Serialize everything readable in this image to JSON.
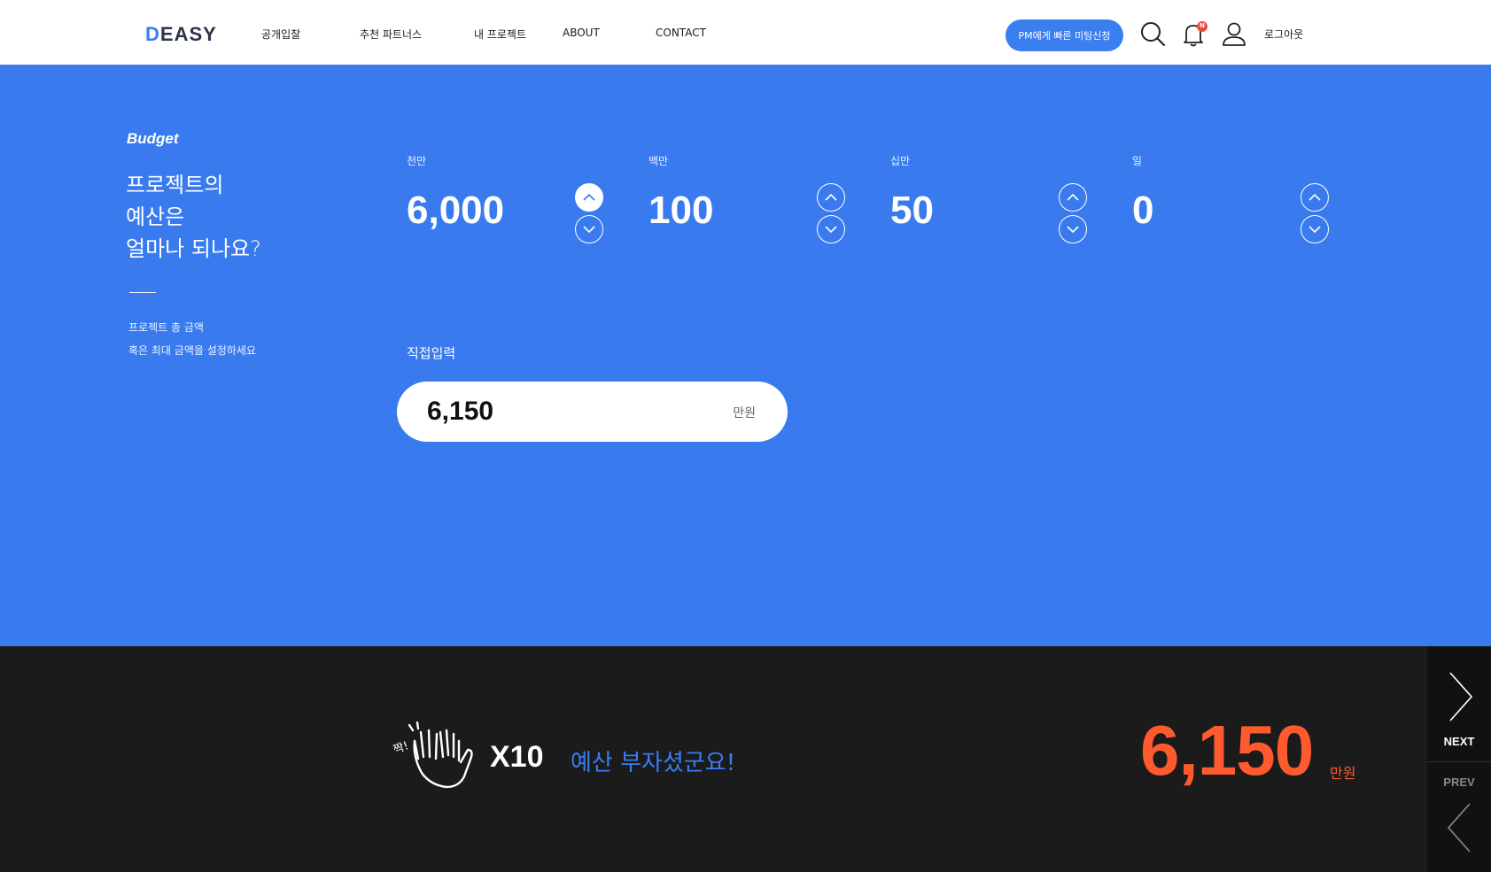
{
  "header": {
    "logo": {
      "accent": "D",
      "rest": "EASY"
    },
    "nav": [
      "공개입찰",
      "추천 파트너스",
      "내 프로젝트",
      "ABOUT",
      "CONTACT"
    ],
    "pm_button": "PM에게 빠른 미팅신청",
    "notification_badge": "N",
    "logout": "로그아웃",
    "icons": [
      "search-icon",
      "bell-icon",
      "user-icon"
    ]
  },
  "budget": {
    "label": "Budget",
    "question": [
      "프로젝트의",
      "예산은",
      "얼마나 되나요?"
    ],
    "description": [
      "프로젝트 총 금액",
      "혹은 최대 금액을 설정하세요"
    ],
    "digits": [
      {
        "label": "천만",
        "value": "6,000"
      },
      {
        "label": "백만",
        "value": "100"
      },
      {
        "label": "십만",
        "value": "50"
      },
      {
        "label": "일",
        "value": "0"
      }
    ],
    "direct": {
      "label": "직접입력",
      "value": "6,150",
      "unit": "만원"
    }
  },
  "summary": {
    "clap_text": "짝!",
    "multiplier": "X10",
    "message": "예산 부자셨군요!",
    "total": "6,150",
    "unit": "만원"
  },
  "pager": {
    "next": "NEXT",
    "prev": "PREV"
  },
  "colors": {
    "primary_blue": "#397bef",
    "accent_orange": "#ff5a2e",
    "dark_bg": "#1b1b1b"
  }
}
